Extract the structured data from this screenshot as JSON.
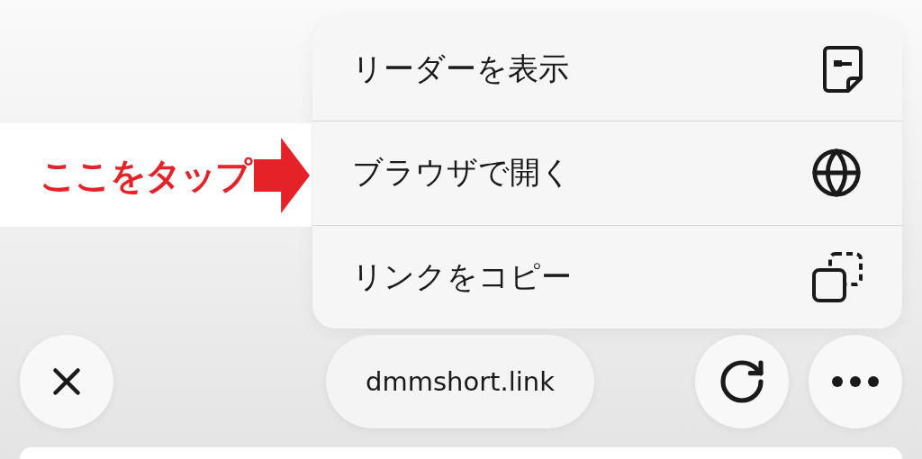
{
  "menu": {
    "items": [
      {
        "label": "リーダーを表示"
      },
      {
        "label": "ブラウザで開く"
      },
      {
        "label": "リンクをコピー"
      }
    ]
  },
  "annotation": {
    "text": "ここをタップ"
  },
  "toolbar": {
    "address": "dmmshort.link"
  }
}
